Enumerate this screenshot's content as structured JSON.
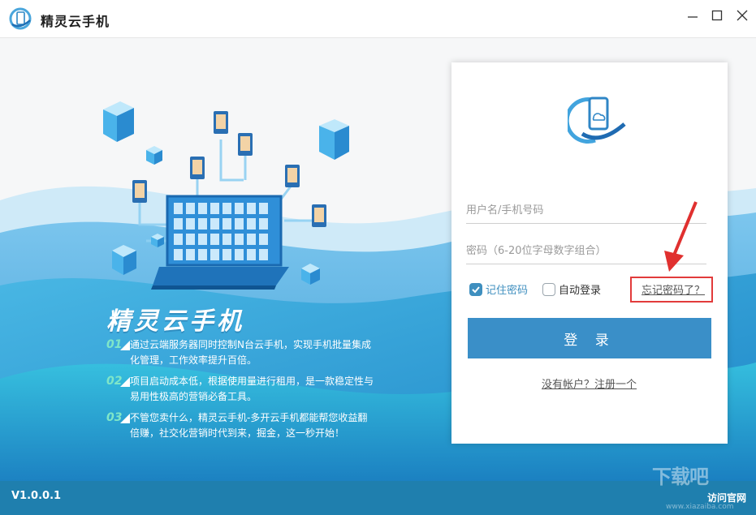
{
  "window": {
    "title": "精灵云手机",
    "minimize_icon": "minimize-icon",
    "maximize_icon": "maximize-icon",
    "close_icon": "close-icon"
  },
  "promo": {
    "brand": "精灵云手机",
    "features": [
      {
        "num": "01",
        "text": "通过云端服务器同时控制N台云手机，实现手机批量集成化管理，工作效率提升百倍。"
      },
      {
        "num": "02",
        "text": "项目启动成本低，根据使用量进行租用，是一款稳定性与易用性极高的营销必备工具。"
      },
      {
        "num": "03",
        "text": "不管您卖什么，精灵云手机-多开云手机都能帮您收益翻倍赚，社交化营销时代到来，掘金，这一秒开始！"
      }
    ]
  },
  "login": {
    "username_placeholder": "用户名/手机号码",
    "password_placeholder": "密码（6-20位字母数字组合）",
    "remember_label": "记住密码",
    "remember_checked": true,
    "auto_login_label": "自动登录",
    "auto_login_checked": false,
    "forgot_label": "忘记密码了？",
    "submit_label": "登 录",
    "register_label": "没有帐户？注册一个"
  },
  "footer": {
    "version": "V1.0.0.1",
    "website_label": "访问官网"
  },
  "watermark": {
    "main": "下载吧",
    "sub": "www.xiazaiba.com"
  },
  "colors": {
    "accent": "#3a8fc8",
    "checkbox": "#3f8fbf",
    "highlight": "#e23b3b",
    "footer": "#1f7fae",
    "feature_number": "#7fe6c8"
  }
}
